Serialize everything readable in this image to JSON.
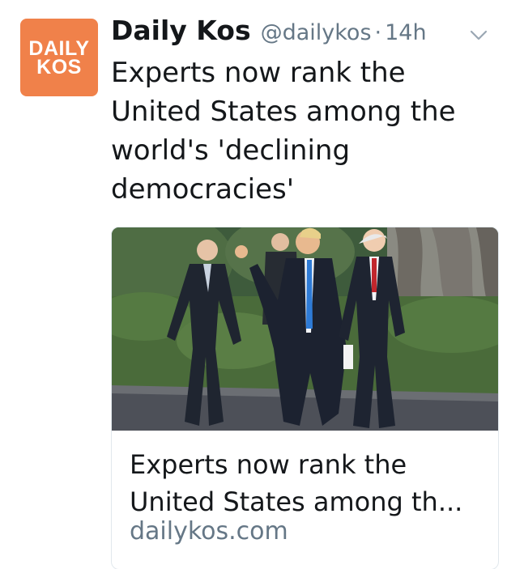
{
  "colors": {
    "brand": "#f0814a",
    "text": "#14171a",
    "muted": "#657786"
  },
  "avatar": {
    "line1": "DAILY",
    "line2": "KOS"
  },
  "header": {
    "name": "Daily Kos",
    "handle": "@dailykos",
    "separator": "·",
    "time": "14h",
    "menu_icon": "chevron-down-icon"
  },
  "tweet": {
    "text": "Experts now rank the United States among the world's 'declining democracies'"
  },
  "card": {
    "image_icon": "photo-of-men-walking",
    "title": "Experts now rank the United States among th...",
    "domain": "dailykos.com"
  }
}
